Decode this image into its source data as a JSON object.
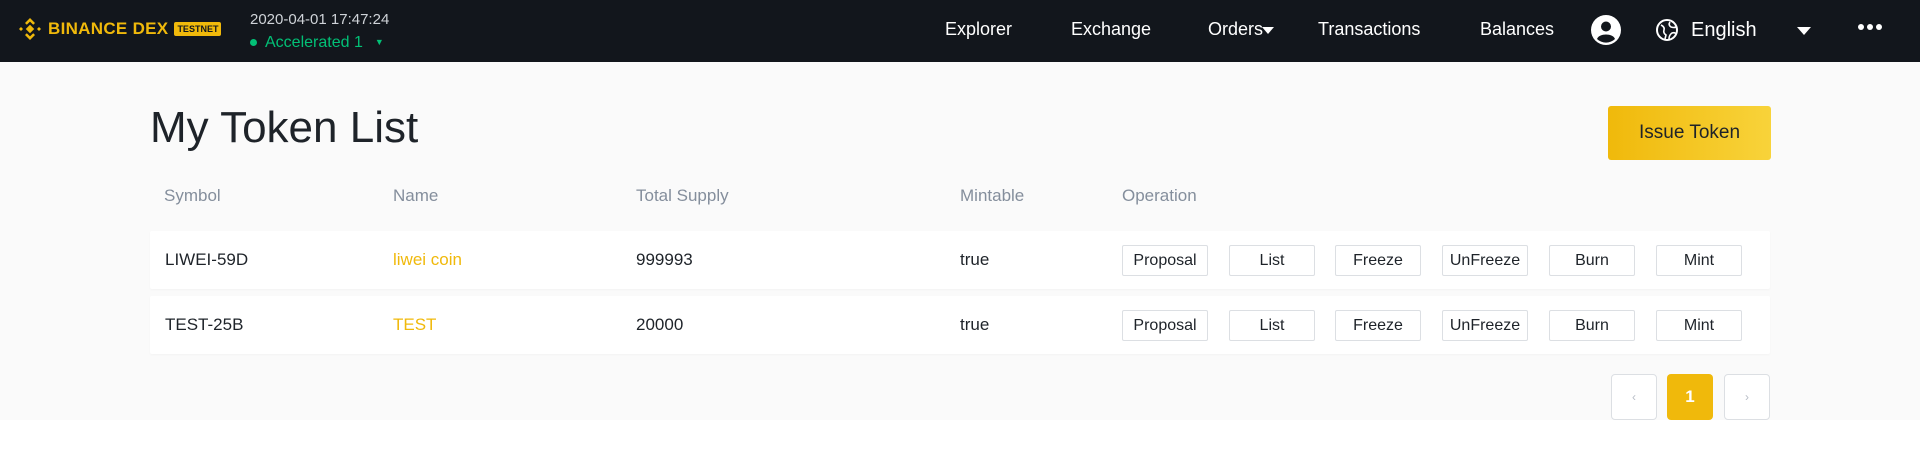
{
  "colors": {
    "accent": "#f0b90b",
    "header_bg": "#12161c",
    "status_green": "#02c076",
    "muted": "#848e9c"
  },
  "header": {
    "brand_text": "BINANCE DEX",
    "brand_badge": "TESTNET",
    "brand_icon": "binance-logo-icon",
    "network": {
      "time": "2020-04-01 17:47:24",
      "status": "Accelerated 1"
    },
    "nav": {
      "explorer": "Explorer",
      "exchange": "Exchange",
      "orders": "Orders",
      "transactions": "Transactions",
      "balances": "Balances",
      "language": "English"
    },
    "icons": [
      "user-icon",
      "globe-icon",
      "more-icon"
    ]
  },
  "page": {
    "title": "My Token List",
    "issue_button": "Issue Token"
  },
  "table": {
    "headers": {
      "symbol": "Symbol",
      "name": "Name",
      "total_supply": "Total Supply",
      "mintable": "Mintable",
      "operation": "Operation"
    },
    "rows": [
      {
        "symbol": "LIWEI-59D",
        "name": "liwei coin",
        "total_supply": "999993",
        "mintable": "true",
        "ops": [
          "Proposal",
          "List",
          "Freeze",
          "UnFreeze",
          "Burn",
          "Mint"
        ]
      },
      {
        "symbol": "TEST-25B",
        "name": "TEST",
        "total_supply": "20000",
        "mintable": "true",
        "ops": [
          "Proposal",
          "List",
          "Freeze",
          "UnFreeze",
          "Burn",
          "Mint"
        ]
      }
    ]
  },
  "pagination": {
    "prev": "‹",
    "current": "1",
    "next": "›"
  }
}
